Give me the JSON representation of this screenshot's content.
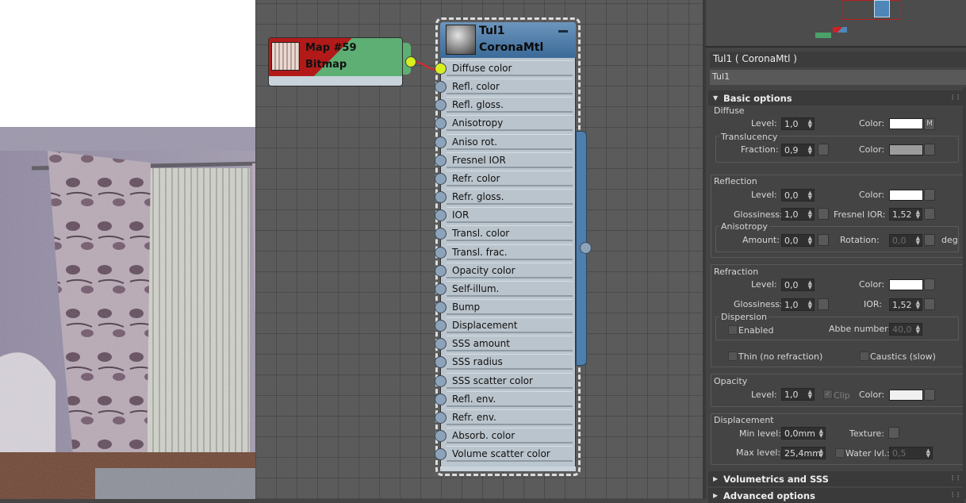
{
  "map_node": {
    "title": "Map #59",
    "type": "Bitmap"
  },
  "material_node": {
    "title": "Tul1",
    "type": "CoronaMtl",
    "slots": [
      "Diffuse color",
      "Refl. color",
      "Refl. gloss.",
      "Anisotropy",
      "Aniso rot.",
      "Fresnel IOR",
      "Refr. color",
      "Refr. gloss.",
      "IOR",
      "Transl. color",
      "Transl. frac.",
      "Opacity color",
      "Self-illum.",
      "Bump",
      "Displacement",
      "SSS amount",
      "SSS radius",
      "SSS scatter color",
      "Refl. env.",
      "Refr. env.",
      "Absorb. color",
      "Volume scatter color"
    ],
    "connected_slot": "Diffuse color"
  },
  "panel": {
    "title": "Tul1  ( CoronaMtl )",
    "name_value": "Tul1",
    "basic_options": {
      "label": "Basic options",
      "diffuse": {
        "header": "Diffuse",
        "level_label": "Level:",
        "level": "1,0",
        "color_label": "Color:",
        "map_button": "M",
        "translucency": {
          "header": "Translucency",
          "fraction_label": "Fraction:",
          "fraction": "0,9",
          "color_label": "Color:"
        }
      },
      "reflection": {
        "header": "Reflection",
        "level_label": "Level:",
        "level": "0,0",
        "color_label": "Color:",
        "glossiness_label": "Glossiness:",
        "glossiness": "1,0",
        "fresnel_label": "Fresnel IOR:",
        "fresnel": "1,52",
        "anisotropy": {
          "header": "Anisotropy",
          "amount_label": "Amount:",
          "amount": "0,0",
          "rotation_label": "Rotation:",
          "rotation": "0,0",
          "unit": "deg"
        }
      },
      "refraction": {
        "header": "Refraction",
        "level_label": "Level:",
        "level": "0,0",
        "color_label": "Color:",
        "glossiness_label": "Glossiness:",
        "glossiness": "1,0",
        "ior_label": "IOR:",
        "ior": "1,52",
        "dispersion": {
          "header": "Dispersion",
          "enabled_label": "Enabled",
          "abbe_label": "Abbe number:",
          "abbe": "40,0"
        },
        "thin_label": "Thin (no refraction)",
        "caustics_label": "Caustics (slow)"
      },
      "opacity": {
        "header": "Opacity",
        "level_label": "Level:",
        "level": "1,0",
        "clip_label": "Clip",
        "color_label": "Color:"
      },
      "displacement": {
        "header": "Displacement",
        "min_label": "Min level:",
        "min": "0,0mm",
        "texture_label": "Texture:",
        "max_label": "Max level:",
        "max": "25,4mm",
        "water_label": "Water lvl.:",
        "water": "0,5"
      }
    },
    "volumetrics_label": "Volumetrics and SSS",
    "advanced_label": "Advanced options"
  },
  "colors": {
    "wire": "#e0272a",
    "active_port": "#d7ef1e",
    "node_header": "#4a79a8",
    "map_green": "#5daf74",
    "map_red": "#b21a1a"
  }
}
